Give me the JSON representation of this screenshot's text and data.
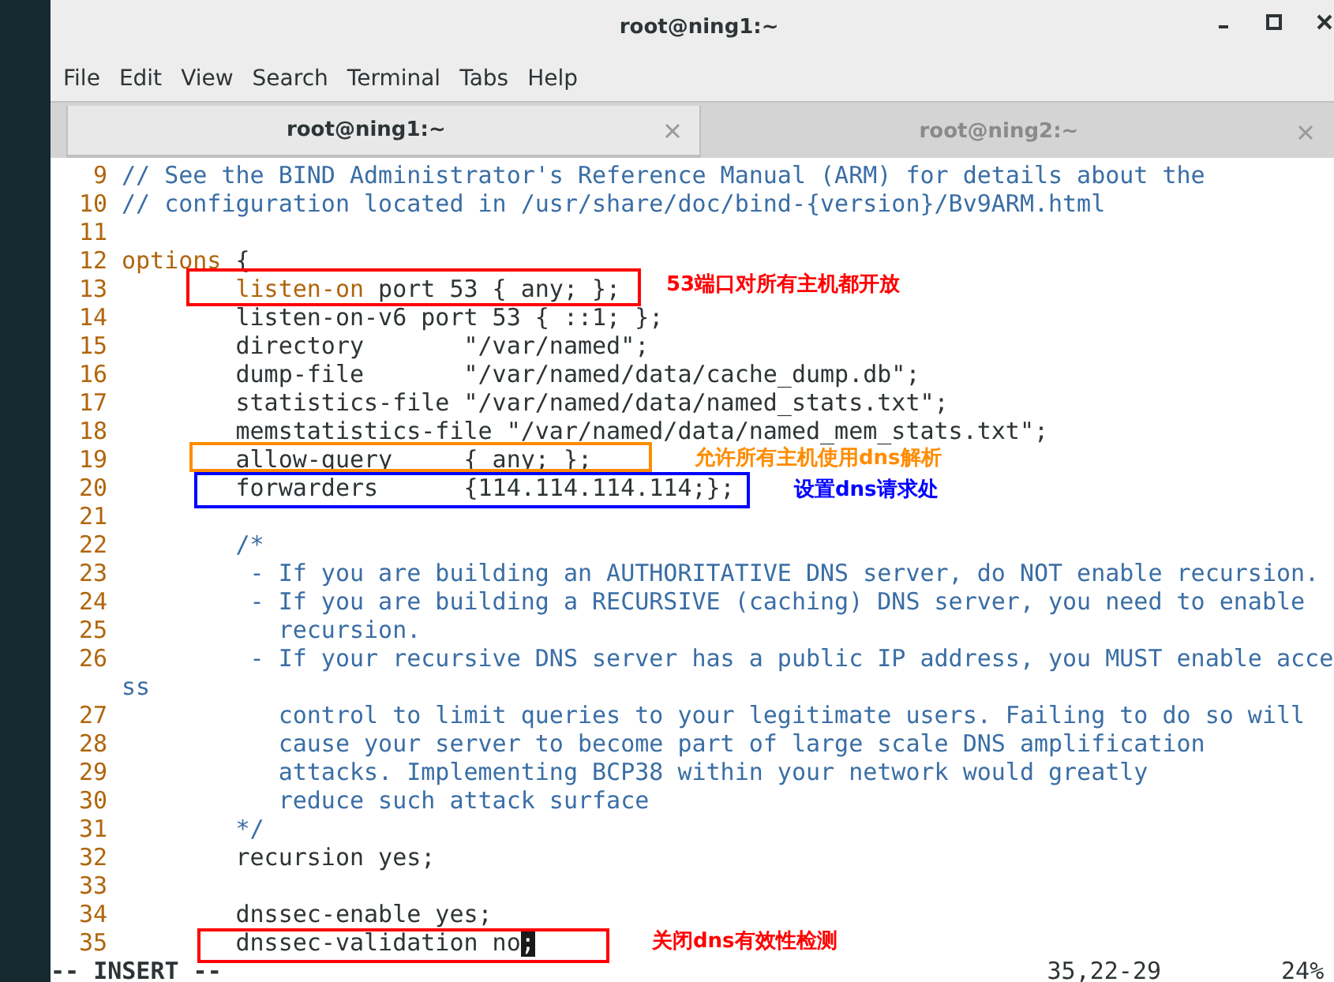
{
  "window": {
    "title": "root@ning1:~"
  },
  "menu": [
    "File",
    "Edit",
    "View",
    "Search",
    "Terminal",
    "Tabs",
    "Help"
  ],
  "tabs": [
    {
      "label": "root@ning1:~",
      "selected": true
    },
    {
      "label": "root@ning2:~",
      "selected": false
    }
  ],
  "lines": [
    {
      "number": "9",
      "segments": [
        {
          "kind": "comment",
          "text": "// See the BIND Administrator's Reference Manual (ARM) for details about the"
        }
      ]
    },
    {
      "number": "10",
      "segments": [
        {
          "kind": "comment",
          "text": "// configuration located in /usr/share/doc/bind-{version}/Bv9ARM.html"
        }
      ]
    },
    {
      "number": "11"
    },
    {
      "number": "12",
      "segments": [
        {
          "kind": "keyword",
          "text": "options"
        },
        {
          "kind": "plain",
          "text": " {"
        }
      ]
    },
    {
      "number": "13",
      "segments": [
        {
          "kind": "keyword",
          "text": "        listen-on"
        },
        {
          "kind": "plain",
          "text": " port 53 { any; };"
        }
      ]
    },
    {
      "number": "14",
      "segments": [
        {
          "kind": "plain",
          "text": "        listen-on-v6 port 53 { ::1; };"
        }
      ]
    },
    {
      "number": "15",
      "segments": [
        {
          "kind": "plain",
          "text": "        directory       \"/var/named\";"
        }
      ]
    },
    {
      "number": "16",
      "segments": [
        {
          "kind": "plain",
          "text": "        dump-file       \"/var/named/data/cache_dump.db\";"
        }
      ]
    },
    {
      "number": "17",
      "segments": [
        {
          "kind": "plain",
          "text": "        statistics-file \"/var/named/data/named_stats.txt\";"
        }
      ]
    },
    {
      "number": "18",
      "segments": [
        {
          "kind": "plain",
          "text": "        memstatistics-file \"/var/named/data/named_mem_stats.txt\";"
        }
      ]
    },
    {
      "number": "19",
      "segments": [
        {
          "kind": "plain",
          "text": "        allow-query     { any; };"
        }
      ]
    },
    {
      "number": "20",
      "segments": [
        {
          "kind": "plain",
          "text": "        forwarders      {114.114.114.114;};"
        }
      ]
    },
    {
      "number": "21"
    },
    {
      "number": "22",
      "segments": [
        {
          "kind": "comment",
          "text": "        /*"
        }
      ]
    },
    {
      "number": "23",
      "segments": [
        {
          "kind": "comment",
          "text": "         - If you are building an AUTHORITATIVE DNS server, do NOT enable recursion."
        }
      ]
    },
    {
      "number": "24",
      "segments": [
        {
          "kind": "comment",
          "text": "         - If you are building a RECURSIVE (caching) DNS server, you need to enable"
        }
      ]
    },
    {
      "number": "25",
      "segments": [
        {
          "kind": "comment",
          "text": "           recursion."
        }
      ]
    },
    {
      "number": "26",
      "segments": [
        {
          "kind": "comment",
          "text": "         - If your recursive DNS server has a public IP address, you MUST enable acce"
        }
      ]
    },
    {
      "segments": [
        {
          "kind": "comment",
          "text": "ss"
        }
      ]
    },
    {
      "number": "27",
      "segments": [
        {
          "kind": "comment",
          "text": "           control to limit queries to your legitimate users. Failing to do so will"
        }
      ]
    },
    {
      "number": "28",
      "segments": [
        {
          "kind": "comment",
          "text": "           cause your server to become part of large scale DNS amplification"
        }
      ]
    },
    {
      "number": "29",
      "segments": [
        {
          "kind": "comment",
          "text": "           attacks. Implementing BCP38 within your network would greatly"
        }
      ]
    },
    {
      "number": "30",
      "segments": [
        {
          "kind": "comment",
          "text": "           reduce such attack surface"
        }
      ]
    },
    {
      "number": "31",
      "segments": [
        {
          "kind": "comment",
          "text": "        */"
        }
      ]
    },
    {
      "number": "32",
      "segments": [
        {
          "kind": "plain",
          "text": "        recursion yes;"
        }
      ]
    },
    {
      "number": "33"
    },
    {
      "number": "34",
      "segments": [
        {
          "kind": "plain",
          "text": "        dnssec-enable yes;"
        }
      ]
    },
    {
      "number": "35",
      "segments": [
        {
          "kind": "plain",
          "text": "        dnssec-validation no"
        },
        {
          "kind": "cursor",
          "text": ";"
        }
      ]
    }
  ],
  "annotations": [
    {
      "note": "53端口对所有主机都开放",
      "color": "#ff0000"
    },
    {
      "note": "允许所有主机使用dns解析",
      "color": "#ff8c00"
    },
    {
      "note": "设置dns请求处",
      "color": "#0000ff"
    },
    {
      "note": "关闭dns有效性检测",
      "color": "#ff0000"
    }
  ],
  "status": {
    "mode": "-- INSERT --",
    "position": "35,22-29",
    "scroll": "24%"
  }
}
